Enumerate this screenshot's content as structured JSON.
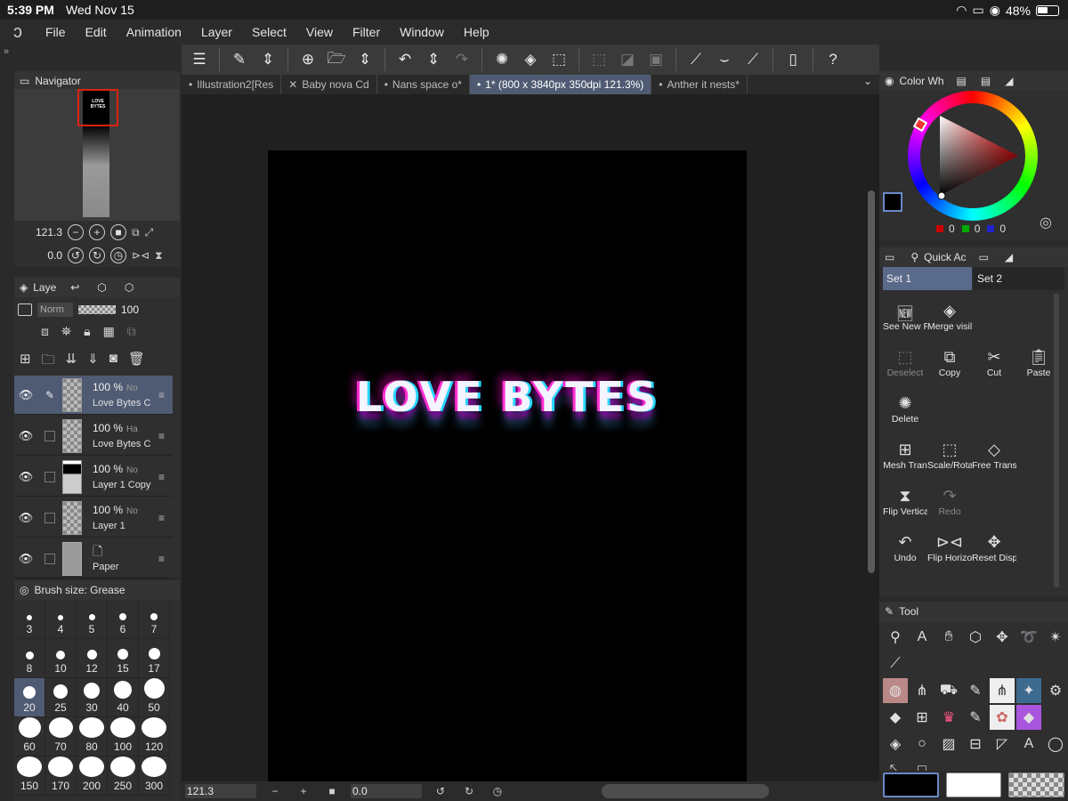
{
  "status_bar": {
    "time": "5:39 PM",
    "date": "Wed Nov 15",
    "battery": "48%"
  },
  "menu": [
    "File",
    "Edit",
    "Animation",
    "Layer",
    "Select",
    "View",
    "Filter",
    "Window",
    "Help"
  ],
  "tabs": [
    {
      "label": "Illustration2[Res",
      "prefix": "•"
    },
    {
      "label": "Baby nova Cd",
      "prefix": "✕"
    },
    {
      "label": "Nans space o*",
      "prefix": "•"
    },
    {
      "label": "1* (800 x 3840px 350dpi 121.3%)",
      "prefix": "•",
      "active": true
    },
    {
      "label": "Anther it nests*",
      "prefix": "•"
    }
  ],
  "artwork_text": "LOVE BYTES",
  "navigator": {
    "title": "Navigator",
    "zoom": "121.3",
    "rotation": "0.0",
    "thumbnail_text": "LOVE BYTES"
  },
  "layers": {
    "title": "Laye",
    "blend_mode": "Norm",
    "opacity": "100",
    "rows": [
      {
        "percent": "100 %",
        "mode": "No",
        "name": "Love Bytes C",
        "selected": true,
        "pen": true,
        "thumb": "checker"
      },
      {
        "percent": "100 %",
        "mode": "Ha",
        "name": "Love Bytes C",
        "selected": false,
        "thumb": "checker"
      },
      {
        "percent": "100 %",
        "mode": "No",
        "name": "Layer 1 Copy",
        "selected": false,
        "thumb": "dark"
      },
      {
        "percent": "100 %",
        "mode": "No",
        "name": "Layer 1",
        "selected": false,
        "thumb": "checker"
      },
      {
        "percent": "",
        "mode": "",
        "name": "Paper",
        "selected": false,
        "thumb": "paper"
      }
    ]
  },
  "brush_size": {
    "title": "Brush size: Grease",
    "sizes": [
      "3",
      "4",
      "5",
      "6",
      "7",
      "8",
      "10",
      "12",
      "15",
      "17",
      "20",
      "25",
      "30",
      "40",
      "50",
      "60",
      "70",
      "80",
      "100",
      "120",
      "150",
      "170",
      "200",
      "250",
      "300"
    ],
    "selected": "20"
  },
  "color_wheel": {
    "title": "Color Wh",
    "r": "0",
    "g": "0",
    "b": "0"
  },
  "quick_access": {
    "title": "Quick Ac",
    "sets": [
      "Set 1",
      "Set 2"
    ],
    "items": [
      {
        "label": "See New F",
        "icon": "new-icon"
      },
      {
        "label": "Merge visil",
        "icon": "merge-icon"
      },
      {
        "label": "",
        "icon": ""
      },
      {
        "label": "",
        "icon": ""
      },
      {
        "label": "Deselect",
        "icon": "deselect-icon",
        "dim": true
      },
      {
        "label": "Copy",
        "icon": "copy-icon"
      },
      {
        "label": "Cut",
        "icon": "cut-icon"
      },
      {
        "label": "Paste",
        "icon": "paste-icon"
      },
      {
        "label": "Delete",
        "icon": "delete-icon"
      },
      {
        "label": "",
        "icon": ""
      },
      {
        "label": "",
        "icon": ""
      },
      {
        "label": "",
        "icon": ""
      },
      {
        "label": "Mesh Tran",
        "icon": "mesh-icon"
      },
      {
        "label": "Scale/Rota",
        "icon": "scale-icon"
      },
      {
        "label": "Free Transf",
        "icon": "free-transform-icon"
      },
      {
        "label": "",
        "icon": ""
      },
      {
        "label": "Flip Vertica",
        "icon": "flip-vertical-icon"
      },
      {
        "label": "Redo",
        "icon": "redo-icon",
        "dim": true
      },
      {
        "label": "",
        "icon": ""
      },
      {
        "label": "",
        "icon": ""
      },
      {
        "label": "Undo",
        "icon": "undo-icon"
      },
      {
        "label": "Flip Horizo",
        "icon": "flip-horizontal-icon"
      },
      {
        "label": "Reset Disp",
        "icon": "reset-display-icon"
      },
      {
        "label": "",
        "icon": ""
      }
    ]
  },
  "tool_panel": {
    "title": "Tool"
  },
  "bottom_bar": {
    "zoom": "121.3",
    "rotation": "0.0"
  }
}
